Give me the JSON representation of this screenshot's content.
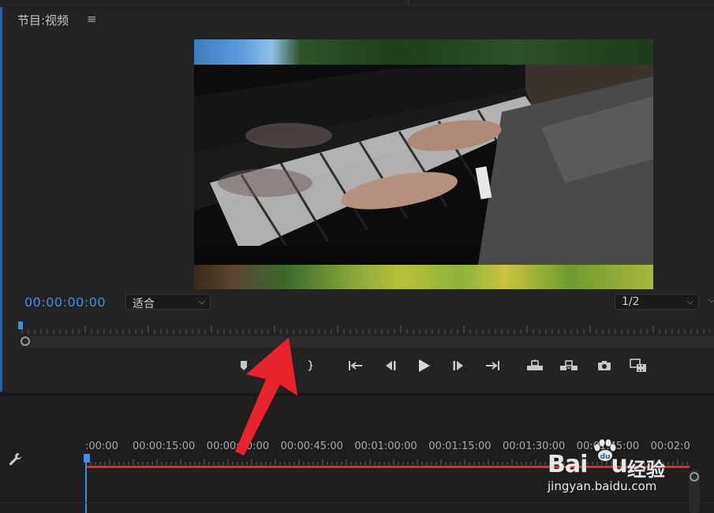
{
  "panel": {
    "title": "节目:视频",
    "menu_icon": "hamburger-icon"
  },
  "monitor": {
    "timecode": "00:00:00:00",
    "fit_select": {
      "value": "适合"
    },
    "resolution_select": {
      "value": "1/2"
    }
  },
  "transport": {
    "icons": [
      "marker-icon",
      "mark-out-icon",
      "go-to-in-icon",
      "step-back-icon",
      "play-icon",
      "step-forward-icon",
      "go-to-out-icon",
      "lift-icon",
      "extract-icon",
      "camera-icon",
      "compare-icon"
    ]
  },
  "timeline": {
    "ruler_labels": [
      ":00:00",
      "00:00:15:00",
      "00:00:30:00",
      "00:00:45:00",
      "00:01:00:00",
      "00:01:15:00",
      "00:01:30:00",
      "00:01:45:00",
      "00:02:0"
    ],
    "settings_icon": "wrench-icon"
  },
  "colors": {
    "accent": "#3f8fe3",
    "clip_red": "#e3272b",
    "annotation_arrow": "#e8232c"
  },
  "watermark": {
    "logo_pre": "Bai",
    "logo_post": "u",
    "cn": "经验",
    "url": "jingyan.baidu.com"
  }
}
